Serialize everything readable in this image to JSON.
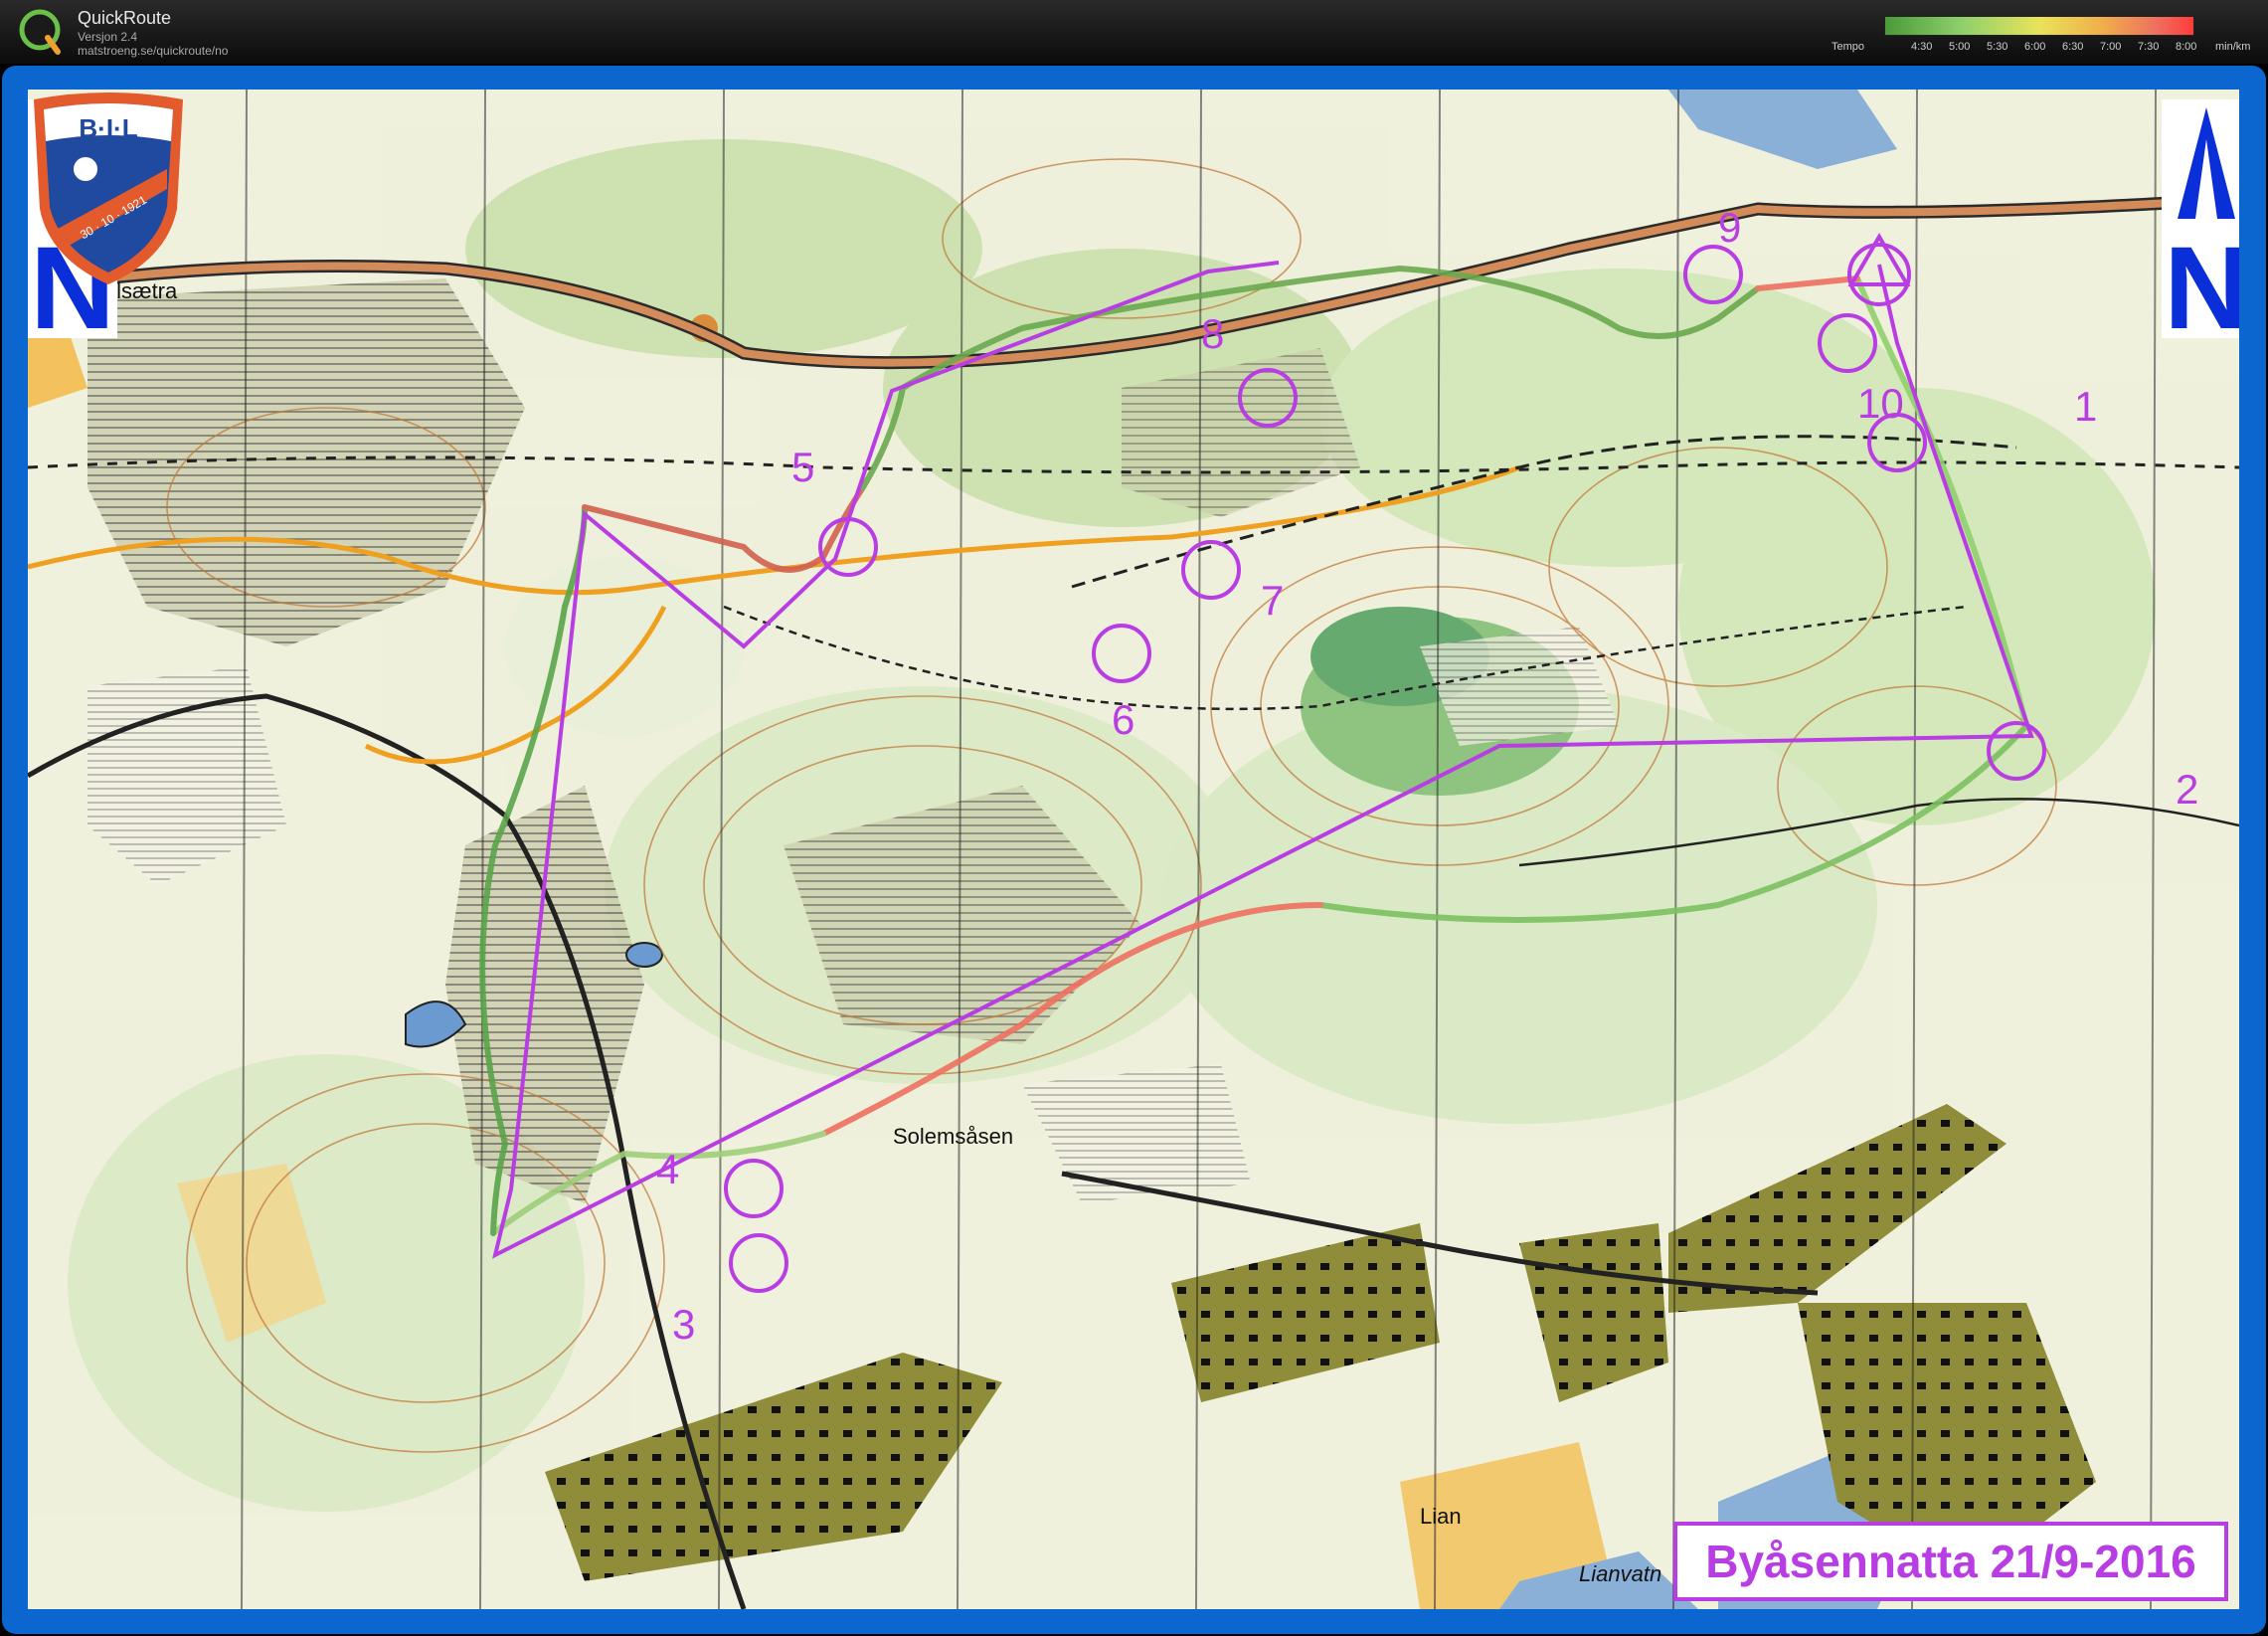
{
  "titlebar": {
    "app_name": "QuickRoute",
    "version": "Versjon 2.4",
    "url": "matstroeng.se/quickroute/no",
    "logo_letter": "Q"
  },
  "tempo_legend": {
    "label": "Tempo",
    "ticks": [
      "4:30",
      "5:00",
      "5:30",
      "6:00",
      "6:30",
      "7:00",
      "7:30",
      "8:00"
    ],
    "unit": "min/km",
    "colors": [
      "#4a9a3a",
      "#8fd06a",
      "#e9e35a",
      "#f0b04a",
      "#ee7060",
      "#ff3b3b"
    ]
  },
  "map": {
    "place_names": {
      "top_left": "ellsætra",
      "center": "Solemsåsen",
      "bottom": "Lian",
      "bottom_lake": "Lianvatn"
    },
    "controls": [
      "1",
      "2",
      "3",
      "4",
      "5",
      "6",
      "7",
      "8",
      "9",
      "10"
    ],
    "course_color": "#b83ee3",
    "frame_color": "#0b67cf",
    "north_arrow_icon": "north-arrow-icon"
  },
  "event_title": "Byåsennatta 21/9-2016",
  "club_logo": {
    "text": "B·I·L",
    "date": "30 · 10 · 1921",
    "icon": "club-shield-icon"
  }
}
